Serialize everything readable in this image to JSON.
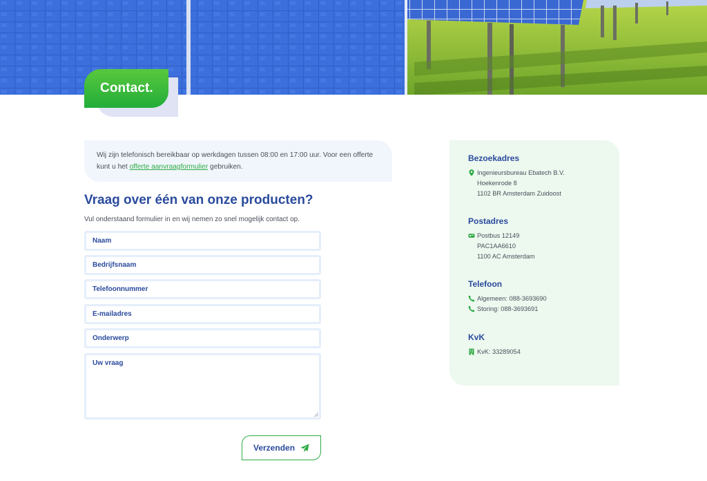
{
  "hero": {
    "badge_label": "Contact."
  },
  "notice": {
    "text_before": "Wij zijn telefonisch bereikbaar op werkdagen tussen 08:00 en 17:00 uur. Voor een offerte kunt u het ",
    "link_label": "offerte aanvraagformulier",
    "text_after": " gebruiken."
  },
  "form": {
    "title": "Vraag over één van onze producten?",
    "intro": "Vul onderstaand formulier in en wij nemen zo snel mogelijk contact op.",
    "fields": [
      "Naam",
      "Bedrijfsnaam",
      "Telefoonnummer",
      "E-mailadres",
      "Onderwerp",
      "Uw vraag"
    ],
    "submit_label": "Verzenden"
  },
  "contact": {
    "visit": {
      "heading": "Bezoekadres",
      "lines": [
        "Ingenieursbureau Ebatech B.V.",
        "Hoekenrode 8",
        "1102 BR Amsterdam Zuidoost"
      ],
      "icon": "map-pin-icon"
    },
    "postal": {
      "heading": "Postadres",
      "lines": [
        "Postbus 12149",
        "PAC1AA6610",
        "1100 AC Amsterdam"
      ],
      "icon": "mailbox-icon"
    },
    "phone": {
      "heading": "Telefoon",
      "lines": [
        "Algemeen: 088-3693690",
        "Storing: 088-3693691"
      ],
      "icon": "phone-icon"
    },
    "kvk": {
      "heading": "KvK",
      "lines": [
        "KvK: 33289054"
      ],
      "icon": "building-icon"
    }
  },
  "colors": {
    "accent_green": "#2eaa44",
    "heading_blue": "#2a4a9c",
    "card_bg": "#edf8ef",
    "notice_bg": "#f1f6fc"
  }
}
